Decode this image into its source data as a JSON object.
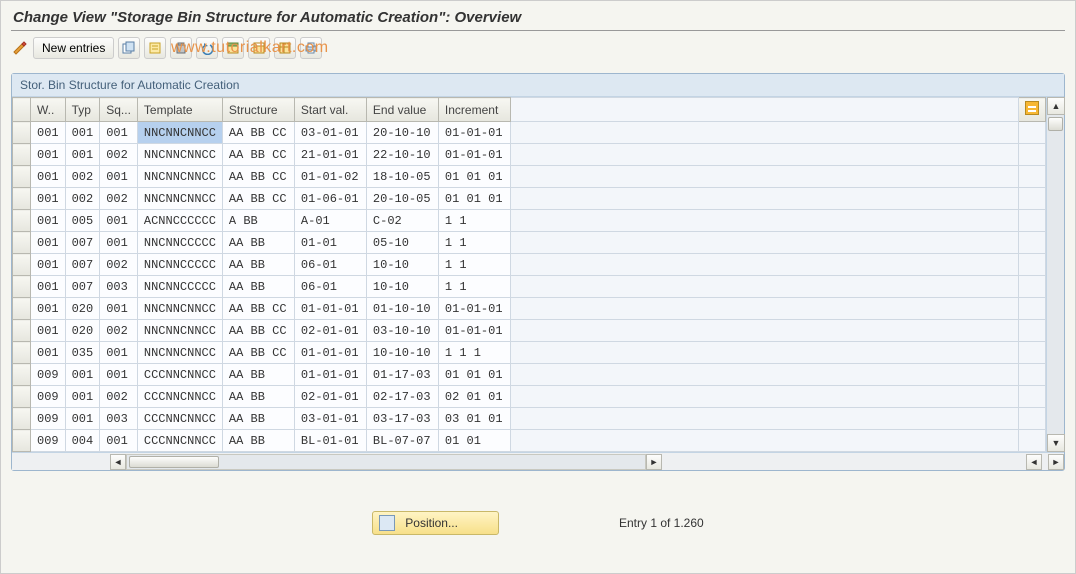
{
  "header": {
    "title": "Change View \"Storage Bin Structure for Automatic Creation\": Overview"
  },
  "watermark": "www.tutorialkart.com",
  "toolbar": {
    "new_entries": "New entries"
  },
  "panel": {
    "title": "Stor. Bin Structure for Automatic Creation"
  },
  "table": {
    "headers": [
      "W..",
      "Typ",
      "Sq...",
      "Template",
      "Structure",
      "Start val.",
      "End value",
      "Increment"
    ],
    "rows": [
      {
        "w": "001",
        "typ": "001",
        "sq": "001",
        "template": "NNCNNCNNCC",
        "structure": "AA BB CC",
        "start": "03-01-01",
        "end": "20-10-10",
        "inc": "01-01-01",
        "sel": true
      },
      {
        "w": "001",
        "typ": "001",
        "sq": "002",
        "template": "NNCNNCNNCC",
        "structure": "AA BB CC",
        "start": "21-01-01",
        "end": "22-10-10",
        "inc": "01-01-01"
      },
      {
        "w": "001",
        "typ": "002",
        "sq": "001",
        "template": "NNCNNCNNCC",
        "structure": "AA BB CC",
        "start": "01-01-02",
        "end": "18-10-05",
        "inc": "01 01 01"
      },
      {
        "w": "001",
        "typ": "002",
        "sq": "002",
        "template": "NNCNNCNNCC",
        "structure": "AA BB CC",
        "start": "01-06-01",
        "end": "20-10-05",
        "inc": "01 01 01"
      },
      {
        "w": "001",
        "typ": "005",
        "sq": "001",
        "template": "ACNNCCCCCC",
        "structure": "A BB",
        "start": "A-01",
        "end": "C-02",
        "inc": "1  1"
      },
      {
        "w": "001",
        "typ": "007",
        "sq": "001",
        "template": "NNCNNCCCCC",
        "structure": "AA BB",
        "start": "01-01",
        "end": "05-10",
        "inc": " 1  1"
      },
      {
        "w": "001",
        "typ": "007",
        "sq": "002",
        "template": "NNCNNCCCCC",
        "structure": "AA BB",
        "start": "06-01",
        "end": "10-10",
        "inc": " 1  1"
      },
      {
        "w": "001",
        "typ": "007",
        "sq": "003",
        "template": "NNCNNCCCCC",
        "structure": "AA BB",
        "start": "06-01",
        "end": "10-10",
        "inc": " 1  1"
      },
      {
        "w": "001",
        "typ": "020",
        "sq": "001",
        "template": "NNCNNCNNCC",
        "structure": "AA BB CC",
        "start": "01-01-01",
        "end": "01-10-10",
        "inc": "01-01-01"
      },
      {
        "w": "001",
        "typ": "020",
        "sq": "002",
        "template": "NNCNNCNNCC",
        "structure": "AA BB CC",
        "start": "02-01-01",
        "end": "03-10-10",
        "inc": "01-01-01"
      },
      {
        "w": "001",
        "typ": "035",
        "sq": "001",
        "template": "NNCNNCNNCC",
        "structure": "AA BB CC",
        "start": "01-01-01",
        "end": "10-10-10",
        "inc": " 1  1  1"
      },
      {
        "w": "009",
        "typ": "001",
        "sq": "001",
        "template": "CCCNNCNNCC",
        "structure": "   AA BB",
        "start": "01-01-01",
        "end": "01-17-03",
        "inc": "01 01 01"
      },
      {
        "w": "009",
        "typ": "001",
        "sq": "002",
        "template": "CCCNNCNNCC",
        "structure": "   AA BB",
        "start": "02-01-01",
        "end": "02-17-03",
        "inc": "02 01 01"
      },
      {
        "w": "009",
        "typ": "001",
        "sq": "003",
        "template": "CCCNNCNNCC",
        "structure": "   AA BB",
        "start": "03-01-01",
        "end": "03-17-03",
        "inc": "03 01 01"
      },
      {
        "w": "009",
        "typ": "004",
        "sq": "001",
        "template": "CCCNNCNNCC",
        "structure": "   AA BB",
        "start": "BL-01-01",
        "end": "BL-07-07",
        "inc": "   01 01"
      }
    ]
  },
  "footer": {
    "position_label": "Position...",
    "entry_text": "Entry 1 of 1.260"
  }
}
